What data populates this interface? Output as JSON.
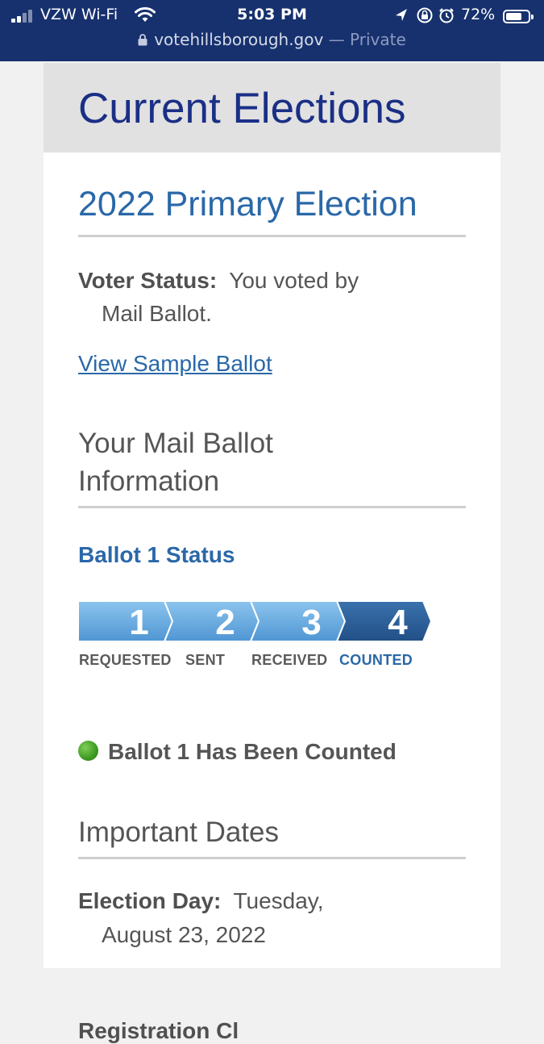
{
  "status_bar": {
    "carrier": "VZW Wi-Fi",
    "time": "5:03 PM",
    "battery": "72%",
    "battery_level_percent": 72,
    "url": "votehillsborough.gov",
    "privacy": "— Private"
  },
  "page": {
    "heading": "Current Elections",
    "election_title": "2022 Primary Election",
    "voter_status_label": "Voter Status:",
    "voter_status_value_1": "You voted by",
    "voter_status_value_2": "Mail Ballot.",
    "sample_ballot_link": "View Sample Ballot",
    "mail_ballot_title_1": "Your Mail Ballot",
    "mail_ballot_title_2": "Information",
    "ballot_status_title": "Ballot 1 Status",
    "steps": [
      {
        "number": "1",
        "label": "REQUESTED"
      },
      {
        "number": "2",
        "label": "SENT"
      },
      {
        "number": "3",
        "label": "RECEIVED"
      },
      {
        "number": "4",
        "label": "COUNTED"
      }
    ],
    "current_step": 4,
    "counted_message": "Ballot 1 Has Been Counted",
    "important_dates_title": "Important Dates",
    "election_day_label": "Election Day:",
    "election_day_value_1": "Tuesday,",
    "election_day_value_2": "August 23, 2022",
    "next_label_partial": "Registration Cl"
  },
  "colors": {
    "status_bar_bg": "#17316e",
    "heading": "#1a2f86",
    "link_blue": "#2a68a8",
    "step_light": "#62a9df",
    "step_dark": "#2a5e98",
    "status_dot": "#3d9a21"
  }
}
